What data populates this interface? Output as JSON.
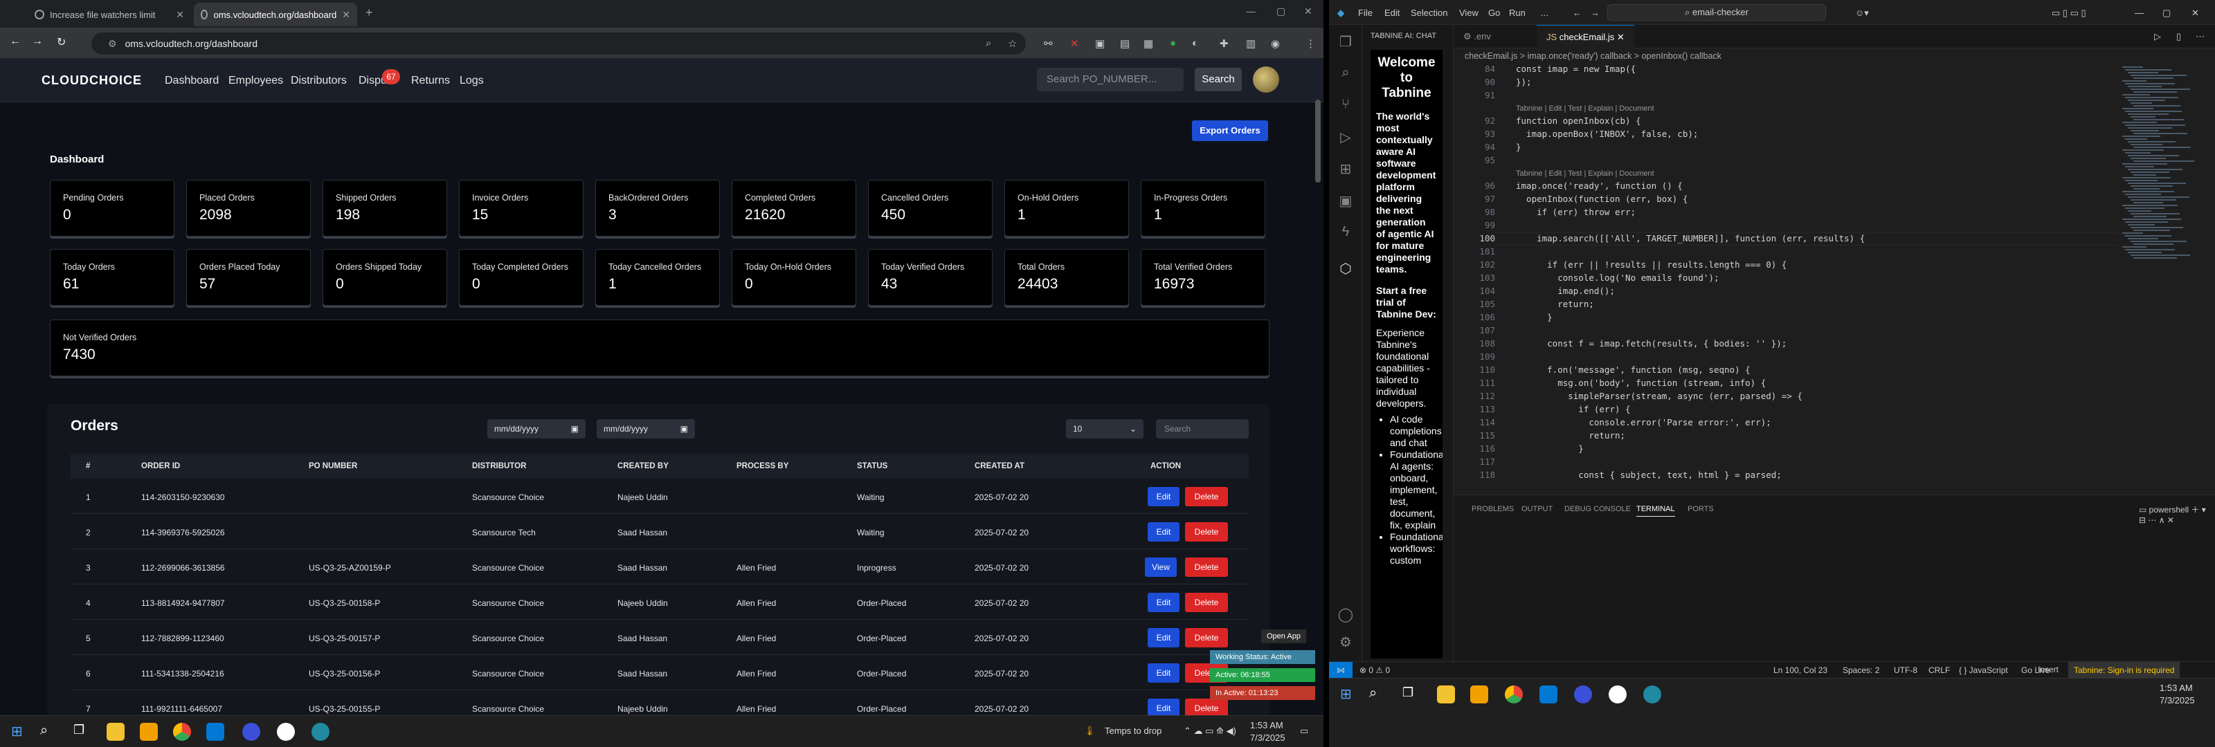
{
  "chrome": {
    "tabs": [
      {
        "title": "Increase file watchers limit",
        "active": false
      },
      {
        "title": "oms.vcloudtech.org/dashboard",
        "active": true
      }
    ],
    "new_tab": "+",
    "address": "oms.vcloudtech.org/dashboard"
  },
  "site": {
    "logo": "CLOUDCHOICE",
    "nav": [
      "Dashboard",
      "Employees",
      "Distributors",
      "Dispu",
      "Returns",
      "Logs"
    ],
    "disputes_badge": "67",
    "search_placeholder": "Search PO_NUMBER...",
    "search_button": "Search",
    "export_button": "Export Orders",
    "dashboard_title": "Dashboard",
    "stats_row1": [
      {
        "label": "Pending Orders",
        "value": "0"
      },
      {
        "label": "Placed Orders",
        "value": "2098"
      },
      {
        "label": "Shipped Orders",
        "value": "198"
      },
      {
        "label": "Invoice Orders",
        "value": "15"
      },
      {
        "label": "BackOrdered Orders",
        "value": "3"
      },
      {
        "label": "Completed Orders",
        "value": "21620"
      },
      {
        "label": "Cancelled Orders",
        "value": "450"
      },
      {
        "label": "On-Hold Orders",
        "value": "1"
      },
      {
        "label": "In-Progress Orders",
        "value": "1"
      }
    ],
    "stats_row2": [
      {
        "label": "Today Orders",
        "value": "61"
      },
      {
        "label": "Orders Placed Today",
        "value": "57"
      },
      {
        "label": "Orders Shipped Today",
        "value": "0"
      },
      {
        "label": "Today Completed Orders",
        "value": "0"
      },
      {
        "label": "Today Cancelled Orders",
        "value": "1"
      },
      {
        "label": "Today On-Hold Orders",
        "value": "0"
      },
      {
        "label": "Today Verified Orders",
        "value": "43"
      },
      {
        "label": "Total Orders",
        "value": "24403"
      },
      {
        "label": "Total Verified Orders",
        "value": "16973"
      }
    ],
    "not_verified": {
      "label": "Not Verified Orders",
      "value": "7430"
    },
    "orders": {
      "title": "Orders",
      "date_placeholder": "mm/dd/yyyy",
      "page_size": "10",
      "search_placeholder": "Search",
      "headers": [
        "#",
        "ORDER ID",
        "PO NUMBER",
        "DISTRIBUTOR",
        "CREATED BY",
        "PROCESS BY",
        "STATUS",
        "CREATED AT",
        "ACTION"
      ],
      "rows": [
        [
          "1",
          "114-2603150-9230630",
          "",
          "Scansource Choice",
          "Najeeb Uddin",
          "",
          "Waiting",
          "2025-07-02 20",
          "Edit"
        ],
        [
          "2",
          "114-3969376-5925026",
          "",
          "Scansource Tech",
          "Saad Hassan",
          "",
          "Waiting",
          "2025-07-02 20",
          "Edit"
        ],
        [
          "3",
          "112-2699066-3613856",
          "US-Q3-25-AZ00159-P",
          "Scansource Choice",
          "Saad Hassan",
          "Allen Fried",
          "Inprogress",
          "2025-07-02 20",
          "View"
        ],
        [
          "4",
          "113-8814924-9477807",
          "US-Q3-25-00158-P",
          "Scansource Choice",
          "Najeeb Uddin",
          "Allen Fried",
          "Order-Placed",
          "2025-07-02 20",
          "Edit"
        ],
        [
          "5",
          "112-7882899-1123460",
          "US-Q3-25-00157-P",
          "Scansource Choice",
          "Saad Hassan",
          "Allen Fried",
          "Order-Placed",
          "2025-07-02 20",
          "Edit"
        ],
        [
          "6",
          "111-5341338-2504216",
          "US-Q3-25-00156-P",
          "Scansource Choice",
          "Saad Hassan",
          "Allen Fried",
          "Order-Placed",
          "2025-07-02 20",
          "Edit"
        ],
        [
          "7",
          "111-9921111-6465007",
          "US-Q3-25-00155-P",
          "Scansource Choice",
          "Najeeb Uddin",
          "Allen Fried",
          "Order-Placed",
          "2025-07-02 20",
          "Edit"
        ]
      ],
      "delete_label": "Delete"
    },
    "popup": {
      "open_app": "Open App",
      "working_status": "Working Status: Active",
      "active": "Active: 06:18:55",
      "inactive": "In Active: 01:13:23"
    }
  },
  "taskbar_left": {
    "weather": "Temps to drop",
    "time": "1:53 AM",
    "date": "7/3/2025"
  },
  "vscode": {
    "menu": [
      "File",
      "Edit",
      "Selection",
      "View",
      "Go",
      "Run",
      "..."
    ],
    "command_center": "email-checker",
    "sidebar_title": "TABNINE AI: CHAT",
    "tabnine": {
      "heading": "Welcome to Tabnine",
      "bold1": "The world's most contextually aware AI software development platform delivering the next generation of agentic AI for mature engineering teams.",
      "bold2": "Start a free trial of Tabnine Dev:",
      "para": "Experience Tabnine's foundational capabilities - tailored to individual developers.",
      "bullets": [
        "AI code completions and chat",
        "Foundational AI agents: onboard, implement, test, document, fix, explain",
        "Foundational workflows: custom"
      ]
    },
    "editor_tabs": [
      ".env",
      "checkEmail.js"
    ],
    "breadcrumb": "checkEmail.js > imap.once('ready') callback > openInbox() callback",
    "code_lens": "Tabnine | Edit | Test | Explain | Document",
    "lines": [
      {
        "n": "84",
        "t": "const imap = new Imap({"
      },
      {
        "n": "90",
        "t": "});"
      },
      {
        "n": "91",
        "t": ""
      },
      {
        "n": "92",
        "t": "function openInbox(cb) {"
      },
      {
        "n": "93",
        "t": "  imap.openBox('INBOX', false, cb);"
      },
      {
        "n": "94",
        "t": "}"
      },
      {
        "n": "95",
        "t": ""
      },
      {
        "n": "96",
        "t": "imap.once('ready', function () {"
      },
      {
        "n": "97",
        "t": "  openInbox(function (err, box) {"
      },
      {
        "n": "98",
        "t": "    if (err) throw err;"
      },
      {
        "n": "99",
        "t": ""
      },
      {
        "n": "100",
        "t": "    imap.search([['All', TARGET_NUMBER]], function (err, results) {"
      },
      {
        "n": "101",
        "t": ""
      },
      {
        "n": "102",
        "t": "      if (err || !results || results.length === 0) {"
      },
      {
        "n": "103",
        "t": "        console.log('No emails found');"
      },
      {
        "n": "104",
        "t": "        imap.end();"
      },
      {
        "n": "105",
        "t": "        return;"
      },
      {
        "n": "106",
        "t": "      }"
      },
      {
        "n": "107",
        "t": ""
      },
      {
        "n": "108",
        "t": "      const f = imap.fetch(results, { bodies: '' });"
      },
      {
        "n": "109",
        "t": ""
      },
      {
        "n": "110",
        "t": "      f.on('message', function (msg, seqno) {"
      },
      {
        "n": "111",
        "t": "        msg.on('body', function (stream, info) {"
      },
      {
        "n": "112",
        "t": "          simpleParser(stream, async (err, parsed) => {"
      },
      {
        "n": "113",
        "t": "            if (err) {"
      },
      {
        "n": "114",
        "t": "              console.error('Parse error:', err);"
      },
      {
        "n": "115",
        "t": "              return;"
      },
      {
        "n": "116",
        "t": "            }"
      },
      {
        "n": "117",
        "t": ""
      },
      {
        "n": "118",
        "t": "            const { subject, text, html } = parsed;"
      }
    ],
    "panel_tabs": [
      "PROBLEMS",
      "OUTPUT",
      "DEBUG CONSOLE",
      "TERMINAL",
      "PORTS"
    ],
    "terminal": "powershell",
    "status": {
      "errors": "⊗ 0 ⚠ 0",
      "position": "Ln 100, Col 23",
      "spaces": "Spaces: 2",
      "encoding": "UTF-8",
      "eol": "CRLF",
      "language": "{ } JavaScript",
      "golive": "Go Live",
      "insert": "Insert",
      "tabnine": "Tabnine: Sign-in is required"
    }
  },
  "taskbar_right": {
    "time": "1:53 AM",
    "date": "7/3/2025"
  }
}
